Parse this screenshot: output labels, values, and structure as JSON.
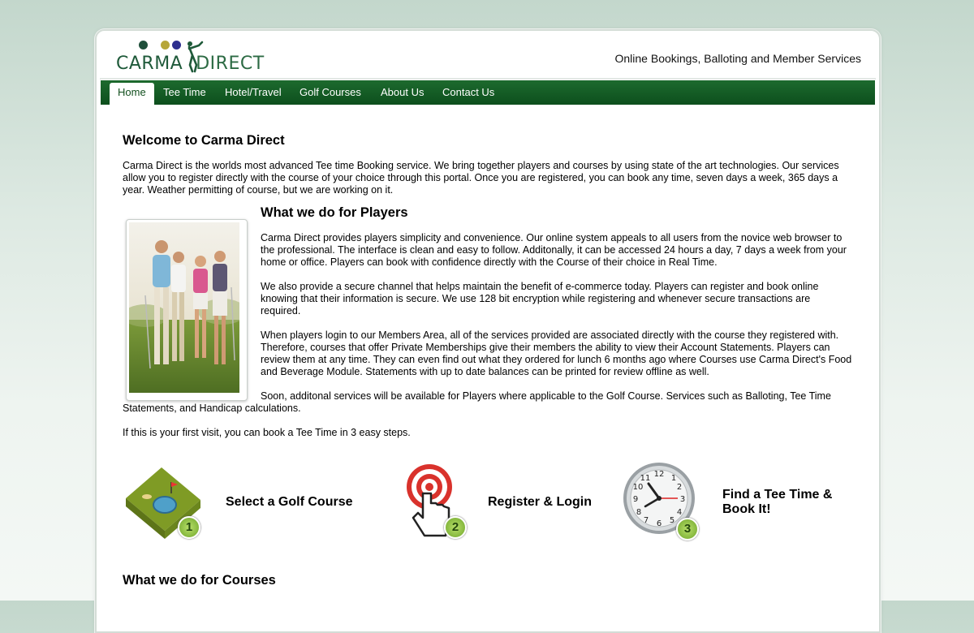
{
  "header": {
    "logo_text_1": "CARMA",
    "logo_text_2": "DIRECT",
    "tagline": "Online Bookings, Balloting and Member Services"
  },
  "nav": {
    "items": [
      "Home",
      "Tee Time",
      "Hotel/Travel",
      "Golf Courses",
      "About Us",
      "Contact Us"
    ],
    "active": "Home"
  },
  "main": {
    "welcome_title": "Welcome to Carma Direct",
    "welcome_text": "Carma Direct is the worlds most advanced Tee time Booking service. We bring together players and courses by using state of the art technologies. Our services allow you to register directly with the course of your choice through this portal. Once you are registered, you can book any time, seven days a week, 365 days a year. Weather permitting of course, but we are working on it.",
    "players_title": "What we do for Players",
    "players_p1": "Carma Direct provides players simplicity and convenience. Our online system appeals to all users from the novice web browser to the professional. The interface is clean and easy to follow. Additonally, it can be accessed 24 hours a day, 7 days a week from your home or office. Players can book with confidence directly with the Course of their choice in Real Time.",
    "players_p2": "We also provide a secure channel that helps maintain the benefit of e-commerce today. Players can register and book online knowing that their information is secure. We use 128 bit encryption while registering and whenever secure transactions are required.",
    "players_p3": "When players login to our Members Area, all of the services provided are associated directly with the course they registered with. Therefore, courses that offer Private Memberships give their members the ability to view their Account Statements. Players can review them at any time. They can even find out what they ordered for lunch 6 months ago where Courses use Carma Direct's Food and Beverage Module. Statements with up to date balances can be printed for review offline as well.",
    "players_p4": "Soon, additonal services will be available for Players where applicable to the Golf Course. Services such as Balloting, Tee Time Statements, and Handicap calculations.",
    "first_visit": "If this is your first visit, you can book a Tee Time in 3 easy steps.",
    "steps": [
      {
        "number": "1",
        "label": "Select a Golf Course",
        "icon": "golf-course-icon"
      },
      {
        "number": "2",
        "label": "Register & Login",
        "icon": "target-pointer-icon"
      },
      {
        "number": "3",
        "label": "Find a Tee Time &\nBook It!",
        "icon": "clock-icon"
      }
    ],
    "courses_title": "What we do for Courses"
  },
  "colors": {
    "nav_green": "#0d4f1d",
    "logo_green": "#1f5a3a",
    "badge_green": "#8fc43a"
  }
}
